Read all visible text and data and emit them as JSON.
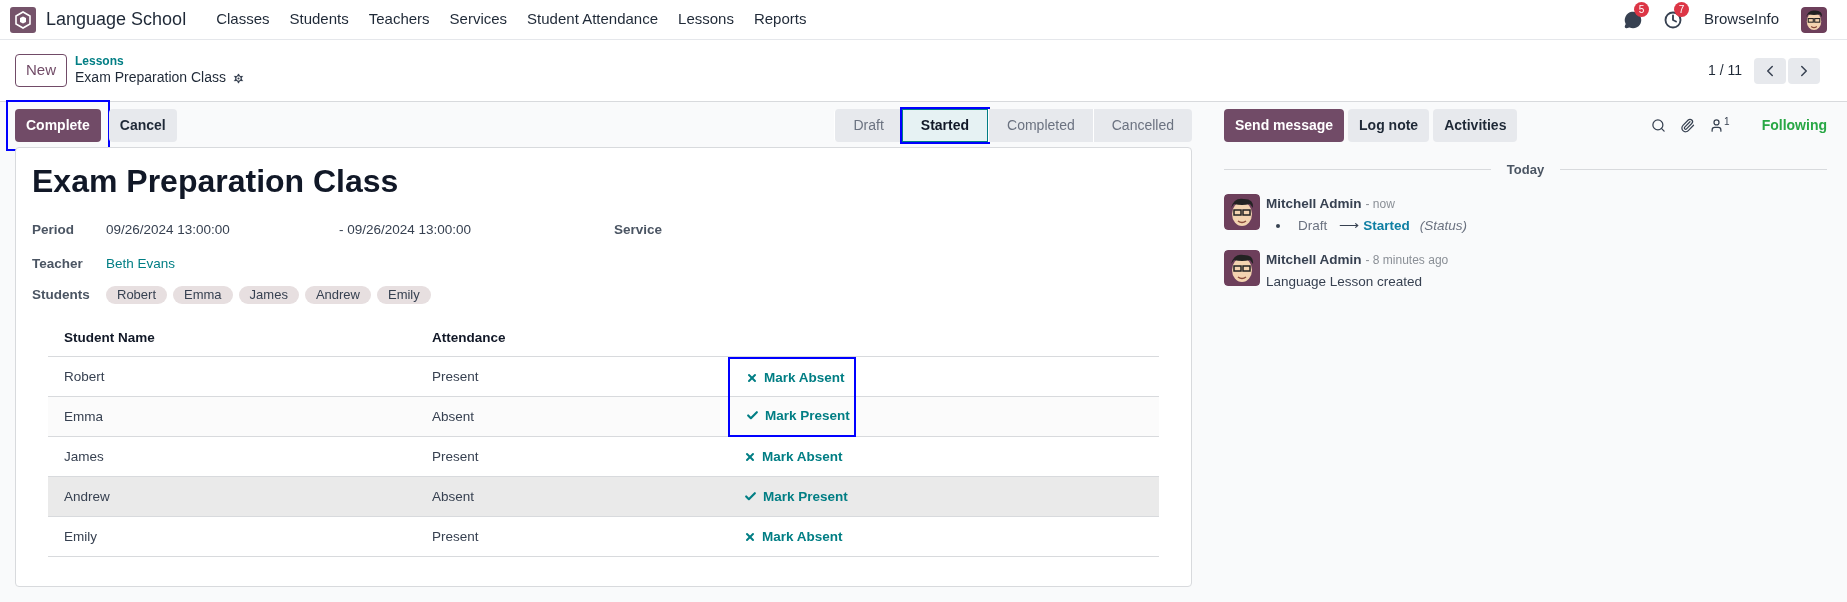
{
  "navbar": {
    "app_name": "Language School",
    "menu": [
      "Classes",
      "Students",
      "Teachers",
      "Services",
      "Student Attendance",
      "Lessons",
      "Reports"
    ],
    "messages_badge": "5",
    "activities_badge": "7",
    "company": "BrowseInfo"
  },
  "control_panel": {
    "new_button": "New",
    "breadcrumb_parent": "Lessons",
    "breadcrumb_current": "Exam Preparation Class",
    "pager": "1 / 11"
  },
  "header_buttons": [
    {
      "label": "Complete",
      "kind": "primary",
      "highlighted": true
    },
    {
      "label": "Cancel",
      "kind": "secondary",
      "highlighted": false
    }
  ],
  "stages": [
    {
      "label": "Draft",
      "selected": false,
      "highlighted": false
    },
    {
      "label": "Started",
      "selected": true,
      "highlighted": true
    },
    {
      "label": "Completed",
      "selected": false,
      "highlighted": false
    },
    {
      "label": "Cancelled",
      "selected": false,
      "highlighted": false
    }
  ],
  "form": {
    "title": "Exam Preparation Class",
    "period_label": "Period",
    "period_start": "09/26/2024 13:00:00",
    "period_end": "- 09/26/2024 13:00:00",
    "service_label": "Service",
    "teacher_label": "Teacher",
    "teacher": "Beth Evans",
    "students_label": "Students",
    "students": [
      "Robert",
      "Emma",
      "James",
      "Andrew",
      "Emily"
    ]
  },
  "table": {
    "columns": [
      "Student Name",
      "Attendance"
    ],
    "rows": [
      {
        "name": "Robert",
        "attendance": "Present",
        "action": "Mark Absent",
        "kind": "absent",
        "highlighted": true,
        "hovered": false
      },
      {
        "name": "Emma",
        "attendance": "Absent",
        "action": "Mark Present",
        "kind": "present",
        "highlighted": true,
        "hovered": false
      },
      {
        "name": "James",
        "attendance": "Present",
        "action": "Mark Absent",
        "kind": "absent",
        "highlighted": false,
        "hovered": false
      },
      {
        "name": "Andrew",
        "attendance": "Absent",
        "action": "Mark Present",
        "kind": "present",
        "highlighted": false,
        "hovered": true
      },
      {
        "name": "Emily",
        "attendance": "Present",
        "action": "Mark Absent",
        "kind": "absent",
        "highlighted": false,
        "hovered": false
      }
    ]
  },
  "chatter": {
    "buttons": [
      {
        "label": "Send message",
        "kind": "primary"
      },
      {
        "label": "Log note",
        "kind": "secondary"
      },
      {
        "label": "Activities",
        "kind": "secondary"
      }
    ],
    "followers_count": "1",
    "following": "Following",
    "date_separator": "Today",
    "messages": [
      {
        "author": "Mitchell Admin",
        "time": "- now",
        "kind": "tracking",
        "old_value": "Draft",
        "arrow": "⟶",
        "new_value": "Started",
        "field": "(Status)"
      },
      {
        "author": "Mitchell Admin",
        "time": "- 8 minutes ago",
        "kind": "text",
        "body": "Language Lesson created"
      }
    ]
  }
}
